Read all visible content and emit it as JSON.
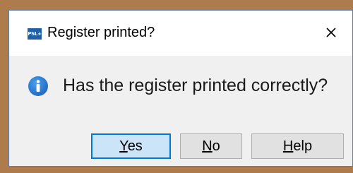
{
  "dialog": {
    "title": "Register printed?",
    "app_icon_text": "PSL+",
    "close_glyph": "✕",
    "message": "Has the register printed correctly?",
    "info_icon": "info-circle-icon",
    "accent_color": "#0078d7",
    "info_color": "#2b7cd3"
  },
  "buttons": {
    "yes": {
      "accel": "Y",
      "rest": "es"
    },
    "no": {
      "accel": "N",
      "rest": "o"
    },
    "help": {
      "accel": "H",
      "rest": "elp"
    }
  }
}
